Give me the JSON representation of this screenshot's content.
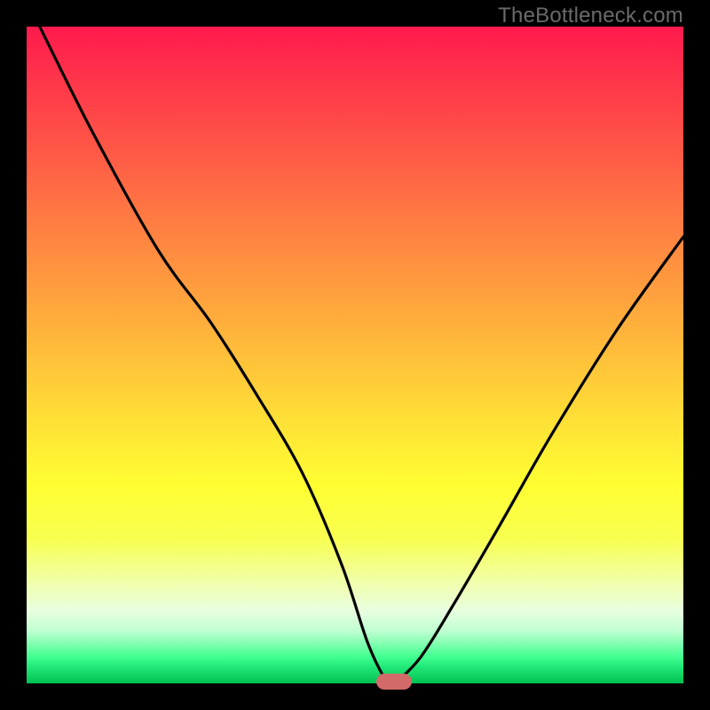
{
  "attribution": "TheBottleneck.com",
  "colors": {
    "frame": "#000000",
    "curve": "#000000",
    "pill": "#d36a6a"
  },
  "chart_data": {
    "type": "line",
    "title": "",
    "xlabel": "",
    "ylabel": "",
    "xlim": [
      0,
      100
    ],
    "ylim": [
      0,
      100
    ],
    "grid": false,
    "legend": false,
    "notes": "Unlabeled bottleneck curve on a red-to-green vertical gradient background. y-axis represents bottleneck severity (top = worst, bottom = best). The curve reaches its minimum (no bottleneck) near x ≈ 56, marked by a small rounded red pill at the baseline. Values estimated from pixel positions; axes have no tick labels.",
    "series": [
      {
        "name": "bottleneck-curve",
        "x": [
          2,
          10,
          20,
          28,
          35,
          42,
          48,
          52,
          55,
          56,
          60,
          65,
          72,
          80,
          90,
          100
        ],
        "y": [
          100,
          84,
          66,
          55,
          44,
          32,
          18,
          6,
          0,
          0,
          4,
          12,
          24,
          38,
          54,
          68
        ]
      }
    ],
    "marker": {
      "x": 56,
      "y": 0,
      "shape": "pill"
    }
  }
}
